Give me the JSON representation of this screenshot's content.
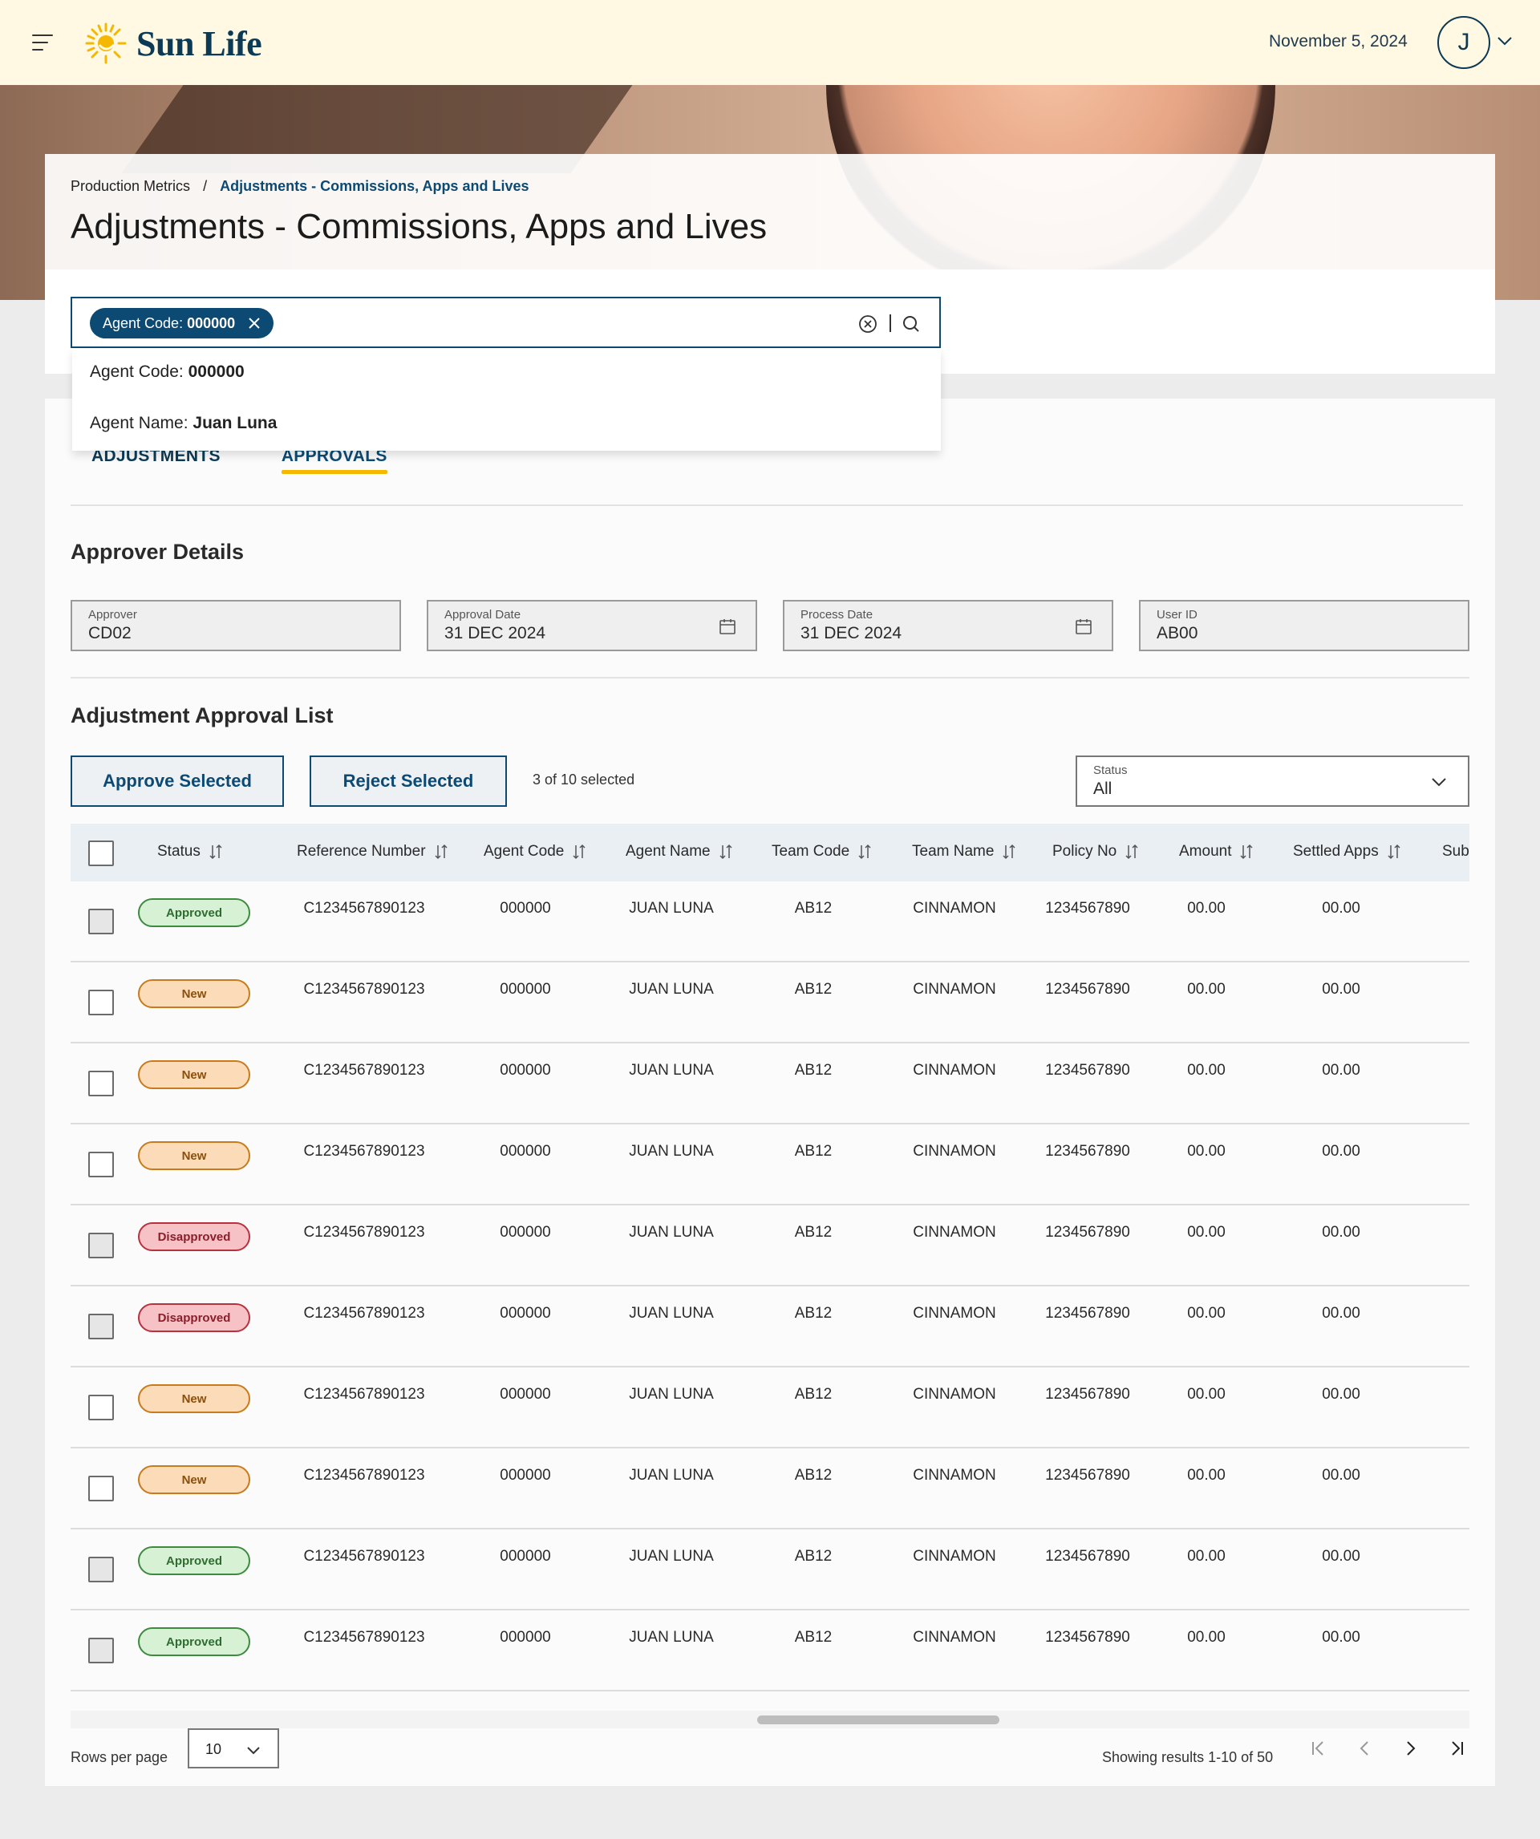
{
  "header": {
    "brand": "Sun Life",
    "date": "November 5, 2024",
    "avatar_initial": "J"
  },
  "breadcrumb": {
    "parent": "Production Metrics",
    "separator": "/",
    "current": "Adjustments - Commissions, Apps and Lives"
  },
  "page_title": "Adjustments - Commissions, Apps and Lives",
  "search": {
    "chip_label": "Agent Code:",
    "chip_value": "000000",
    "suggestions": [
      {
        "label": "Agent Code:",
        "value": "000000"
      },
      {
        "label": "Agent Name:",
        "value": "Juan Luna"
      }
    ]
  },
  "tabs": [
    {
      "label": "ADJUSTMENTS",
      "active": false
    },
    {
      "label": "APPROVALS",
      "active": true
    }
  ],
  "approver_details": {
    "heading": "Approver Details",
    "fields": [
      {
        "label": "Approver",
        "value": "CD02",
        "icon": null
      },
      {
        "label": "Approval Date",
        "value": "31 DEC 2024",
        "icon": "calendar-icon"
      },
      {
        "label": "Process Date",
        "value": "31 DEC 2024",
        "icon": "calendar-icon"
      },
      {
        "label": "User ID",
        "value": "AB00",
        "icon": null
      }
    ]
  },
  "approval_list": {
    "heading": "Adjustment Approval List",
    "approve_label": "Approve Selected",
    "reject_label": "Reject Selected",
    "selected_text": "3 of 10 selected",
    "status_filter": {
      "label": "Status",
      "value": "All"
    },
    "columns": [
      "Status",
      "Reference Number",
      "Agent Code",
      "Agent Name",
      "Team Code",
      "Team Name",
      "Policy No",
      "Amount",
      "Settled Apps",
      "Sub"
    ],
    "rows": [
      {
        "checked": true,
        "status": "Approved",
        "ref": "C1234567890123",
        "agent_code": "000000",
        "agent_name": "JUAN LUNA",
        "team_code": "AB12",
        "team_name": "CINNAMON",
        "policy": "1234567890",
        "amount": "00.00",
        "settled": "00.00"
      },
      {
        "checked": false,
        "status": "New",
        "ref": "C1234567890123",
        "agent_code": "000000",
        "agent_name": "JUAN LUNA",
        "team_code": "AB12",
        "team_name": "CINNAMON",
        "policy": "1234567890",
        "amount": "00.00",
        "settled": "00.00"
      },
      {
        "checked": false,
        "status": "New",
        "ref": "C1234567890123",
        "agent_code": "000000",
        "agent_name": "JUAN LUNA",
        "team_code": "AB12",
        "team_name": "CINNAMON",
        "policy": "1234567890",
        "amount": "00.00",
        "settled": "00.00"
      },
      {
        "checked": false,
        "status": "New",
        "ref": "C1234567890123",
        "agent_code": "000000",
        "agent_name": "JUAN LUNA",
        "team_code": "AB12",
        "team_name": "CINNAMON",
        "policy": "1234567890",
        "amount": "00.00",
        "settled": "00.00"
      },
      {
        "checked": true,
        "status": "Disapproved",
        "ref": "C1234567890123",
        "agent_code": "000000",
        "agent_name": "JUAN LUNA",
        "team_code": "AB12",
        "team_name": "CINNAMON",
        "policy": "1234567890",
        "amount": "00.00",
        "settled": "00.00"
      },
      {
        "checked": true,
        "status": "Disapproved",
        "ref": "C1234567890123",
        "agent_code": "000000",
        "agent_name": "JUAN LUNA",
        "team_code": "AB12",
        "team_name": "CINNAMON",
        "policy": "1234567890",
        "amount": "00.00",
        "settled": "00.00"
      },
      {
        "checked": false,
        "status": "New",
        "ref": "C1234567890123",
        "agent_code": "000000",
        "agent_name": "JUAN LUNA",
        "team_code": "AB12",
        "team_name": "CINNAMON",
        "policy": "1234567890",
        "amount": "00.00",
        "settled": "00.00"
      },
      {
        "checked": false,
        "status": "New",
        "ref": "C1234567890123",
        "agent_code": "000000",
        "agent_name": "JUAN LUNA",
        "team_code": "AB12",
        "team_name": "CINNAMON",
        "policy": "1234567890",
        "amount": "00.00",
        "settled": "00.00"
      },
      {
        "checked": true,
        "status": "Approved",
        "ref": "C1234567890123",
        "agent_code": "000000",
        "agent_name": "JUAN LUNA",
        "team_code": "AB12",
        "team_name": "CINNAMON",
        "policy": "1234567890",
        "amount": "00.00",
        "settled": "00.00"
      },
      {
        "checked": true,
        "status": "Approved",
        "ref": "C1234567890123",
        "agent_code": "000000",
        "agent_name": "JUAN LUNA",
        "team_code": "AB12",
        "team_name": "CINNAMON",
        "policy": "1234567890",
        "amount": "00.00",
        "settled": "00.00"
      }
    ]
  },
  "pagination": {
    "rows_per_page_label": "Rows per page",
    "rows_per_page": "10",
    "results_text": "Showing results 1-10 of 50"
  },
  "colors": {
    "brand_navy": "#0c4a73",
    "header_bg": "#fff8e3",
    "tab_underline": "#f5b800",
    "approved": "#3d8b3f",
    "new": "#c77b1c",
    "disapproved": "#b8313f"
  }
}
